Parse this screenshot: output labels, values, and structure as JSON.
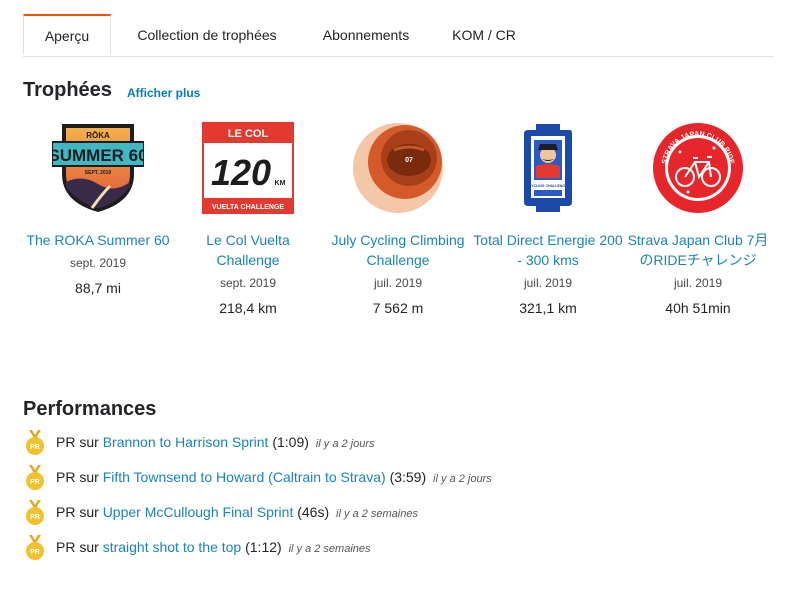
{
  "tabs": [
    {
      "label": "Aperçu",
      "active": true
    },
    {
      "label": "Collection de trophées",
      "active": false
    },
    {
      "label": "Abonnements",
      "active": false
    },
    {
      "label": "KOM / CR",
      "active": false
    }
  ],
  "trophies": {
    "title": "Trophées",
    "more_label": "Afficher plus",
    "badge_texts": {
      "roka_brand": "RŌKA",
      "roka_main": "SUMMER 60",
      "roka_date": "SEPT. 2019",
      "lecol_brand": "LE COL",
      "lecol_number": "120",
      "lecol_unit": "KM",
      "lecol_footer": "VUELTA CHALLENGE",
      "july_number": "07",
      "td_footer": "CYCLING CHALLENGE",
      "sjc_ring": "STRAVA JAPAN CLUB RIDE"
    },
    "items": [
      {
        "name": "The ROKA Summer 60",
        "date": "sept. 2019",
        "value": "88,7 mi",
        "icon": "roka-summer-60-badge"
      },
      {
        "name": "Le Col Vuelta Challenge",
        "date": "sept. 2019",
        "value": "218,4 km",
        "icon": "le-col-vuelta-badge"
      },
      {
        "name": "July Cycling Climbing Challenge",
        "date": "juil. 2019",
        "value": "7 562 m",
        "icon": "july-climbing-badge"
      },
      {
        "name": "Total Direct Energie 200 - 300 kms",
        "date": "juil. 2019",
        "value": "321,1 km",
        "icon": "total-direct-energie-badge"
      },
      {
        "name": "Strava Japan Club 7月のRIDEチャレンジ",
        "date": "juil. 2019",
        "value": "40h 51min",
        "icon": "strava-japan-club-badge"
      }
    ]
  },
  "performances": {
    "title": "Performances",
    "items": [
      {
        "prefix": "PR sur",
        "segment": "Brannon to Harrison Sprint",
        "time": "(1:09)",
        "ago": "il y a 2 jours"
      },
      {
        "prefix": "PR sur",
        "segment": "Fifth Townsend to Howard (Caltrain to Strava)",
        "time": "(3:59)",
        "ago": "il y a 2 jours"
      },
      {
        "prefix": "PR sur",
        "segment": "Upper McCullough Final Sprint",
        "time": "(46s)",
        "ago": "il y a 2 semaines"
      },
      {
        "prefix": "PR sur",
        "segment": "straight shot to the top",
        "time": "(1:12)",
        "ago": "il y a 2 semaines"
      }
    ],
    "medal_label": "PR"
  },
  "colors": {
    "accent": "#fc5200",
    "link": "#1a85b5",
    "medal": "#f2c12e"
  }
}
